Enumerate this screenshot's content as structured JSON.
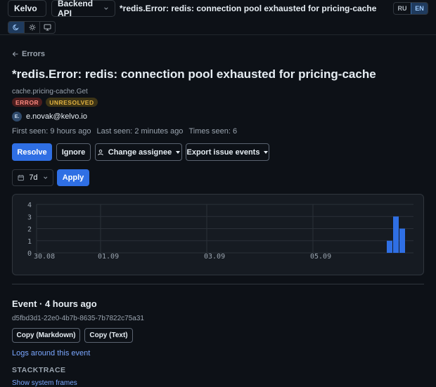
{
  "topbar": {
    "org_label": "Kelvo",
    "project_label": "Backend API",
    "issue_title": "*redis.Error: redis: connection pool exhausted for pricing-cache",
    "languages": [
      "RU",
      "EN"
    ],
    "active_language": "EN",
    "theme_modes": [
      "moon-icon",
      "sun-icon",
      "monitor-icon"
    ]
  },
  "breadcrumb": {
    "back_label": "Errors"
  },
  "issue": {
    "title": "*redis.Error: redis: connection pool exhausted for pricing-cache",
    "culprit": "cache.pricing-cache.Get",
    "level_badge": "ERROR",
    "status_badge": "UNRESOLVED",
    "assignee_initials": "E.",
    "assignee_email": "e.novak@kelvo.io",
    "first_seen": "First seen: 9 hours ago",
    "last_seen": "Last seen: 2 minutes ago",
    "times_seen": "Times seen: 6"
  },
  "actions": {
    "resolve": "Resolve",
    "ignore": "Ignore",
    "change_assignee": "Change assignee",
    "export_events": "Export issue events"
  },
  "filter": {
    "range_value": "7d",
    "apply": "Apply"
  },
  "chart_data": {
    "type": "bar",
    "y_ticks": [
      "4",
      "3",
      "2",
      "1",
      "0"
    ],
    "ylim": [
      0,
      4
    ],
    "x_tick_labels": [
      "30.08",
      "01.09",
      "03.09",
      "05.09"
    ],
    "series": [
      {
        "values": [
          1,
          3,
          2
        ]
      }
    ],
    "grid": true,
    "colors": {
      "bar": "#2f6fe4"
    }
  },
  "event": {
    "heading": "Event · 4 hours ago",
    "id": "d5fbd3d1-22e0-4b7b-8635-7b7822c75a31",
    "copy_markdown": "Copy (Markdown)",
    "copy_text": "Copy (Text)",
    "logs_link": "Logs around this event",
    "stacktrace_label": "STACKTRACE",
    "system_frames_link": "Show system frames"
  }
}
